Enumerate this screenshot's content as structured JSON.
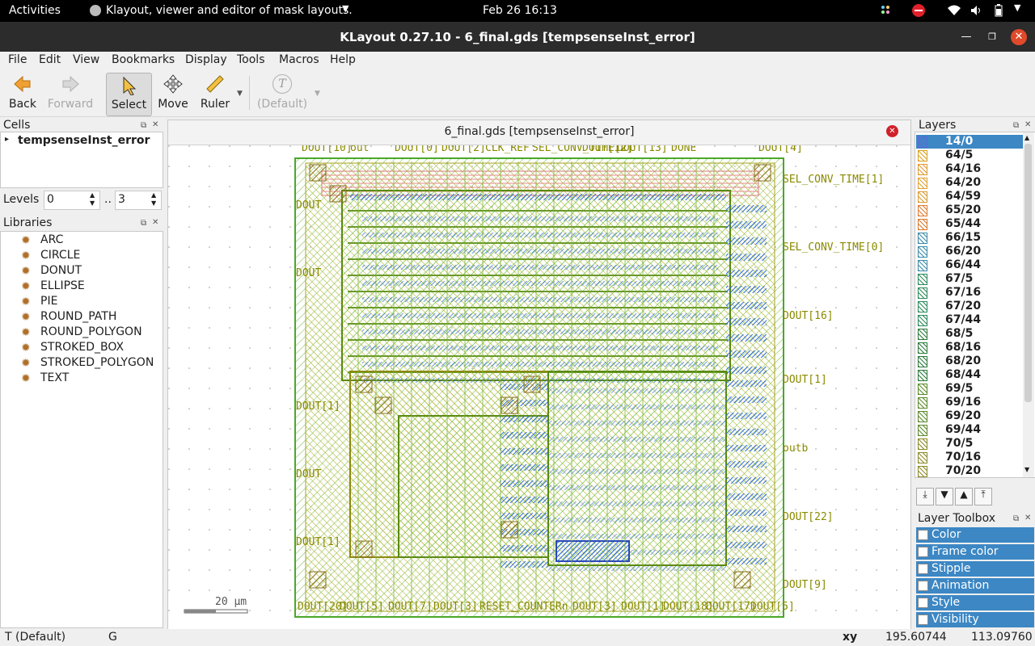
{
  "topbar": {
    "activities": "Activities",
    "app_title": "Klayout, viewer and editor of mask layouts.",
    "clock": "Feb 26  16:13"
  },
  "window": {
    "title": "KLayout 0.27.10 - 6_final.gds [tempsenseInst_error]"
  },
  "menu": [
    "File",
    "Edit",
    "View",
    "Bookmarks",
    "Display",
    "Tools",
    "Macros",
    "Help"
  ],
  "toolbar": {
    "back": "Back",
    "forward": "Forward",
    "select": "Select",
    "move": "Move",
    "ruler": "Ruler",
    "default": "(Default)"
  },
  "cells": {
    "header": "Cells",
    "top_cell": "tempsenseInst_error",
    "levels_label": "Levels",
    "level_from": "0",
    "level_sep": "..",
    "level_to": "3"
  },
  "libraries": {
    "header": "Libraries",
    "items": [
      "ARC",
      "CIRCLE",
      "DONUT",
      "ELLIPSE",
      "PIE",
      "ROUND_PATH",
      "ROUND_POLYGON",
      "STROKED_BOX",
      "STROKED_POLYGON",
      "TEXT"
    ]
  },
  "canvas": {
    "tab_title": "6_final.gds [tempsenseInst_error]",
    "scale_label": "20 µm",
    "pin_labels_top": [
      "DOUT[10]",
      "out",
      "DOUT[0]",
      "DOUT[2]",
      "CLK_REF",
      "SEL_CONV_TIME[2]",
      "DOUT[12]",
      "DOUT[13]",
      "DONE",
      "DOUT[4]"
    ],
    "pin_labels_right": [
      "SEL_CONV_TIME[1]",
      "SEL_CONV_TIME[0]",
      "DOUT[16]",
      "DOUT[1]",
      "outb",
      "DOUT[22]",
      "DOUT[9]"
    ],
    "pin_labels_bottom": [
      "DOUT[20]",
      "DOUT[5]",
      "DOUT[7]",
      "DOUT[3]",
      "RESET_COUNTERn",
      "DOUT[3]",
      "DOUT[1]",
      "DOUT[18]",
      "DOUT[17]",
      "DOUT[5]"
    ],
    "pin_labels_left": [
      "DOUT",
      "DOUT",
      "DOUT[1]",
      "DOUT",
      "DOUT[1]"
    ]
  },
  "layers": {
    "header": "Layers",
    "items": [
      {
        "name": "14/0",
        "color": "#5a6ad8",
        "selected": true
      },
      {
        "name": "64/5",
        "color": "#d8a020"
      },
      {
        "name": "64/16",
        "color": "#e09a30"
      },
      {
        "name": "64/20",
        "color": "#e0a030"
      },
      {
        "name": "64/59",
        "color": "#d89a30"
      },
      {
        "name": "65/20",
        "color": "#e07a30"
      },
      {
        "name": "65/44",
        "color": "#d87a2c"
      },
      {
        "name": "66/15",
        "color": "#3a8aa8"
      },
      {
        "name": "66/20",
        "color": "#3a8aa8"
      },
      {
        "name": "66/44",
        "color": "#3a8aa8"
      },
      {
        "name": "67/5",
        "color": "#2a8a5a"
      },
      {
        "name": "67/16",
        "color": "#2a8a5a"
      },
      {
        "name": "67/20",
        "color": "#2a8a5a"
      },
      {
        "name": "67/44",
        "color": "#2a8a5a"
      },
      {
        "name": "68/5",
        "color": "#2a7a3a"
      },
      {
        "name": "68/16",
        "color": "#2a7a3a"
      },
      {
        "name": "68/20",
        "color": "#2a7a3a"
      },
      {
        "name": "68/44",
        "color": "#2a7a3a"
      },
      {
        "name": "69/5",
        "color": "#5a8a2a"
      },
      {
        "name": "69/16",
        "color": "#5a8a2a"
      },
      {
        "name": "69/20",
        "color": "#5a8a2a"
      },
      {
        "name": "69/44",
        "color": "#5a8a2a"
      },
      {
        "name": "70/5",
        "color": "#8a8a2a"
      },
      {
        "name": "70/16",
        "color": "#8a8a2a"
      },
      {
        "name": "70/20",
        "color": "#8a8a2a"
      }
    ]
  },
  "layer_toolbox": {
    "header": "Layer Toolbox",
    "items": [
      "Color",
      "Frame color",
      "Stipple",
      "Animation",
      "Style",
      "Visibility"
    ]
  },
  "status": {
    "mode": "T  (Default)",
    "g": "G",
    "xy_label": "xy",
    "x": "195.60744",
    "y": "113.09760"
  },
  "colors": {
    "selection_blue": "#3c87c4",
    "close_red": "#d0202a",
    "pin_label": "#8a8a00"
  }
}
